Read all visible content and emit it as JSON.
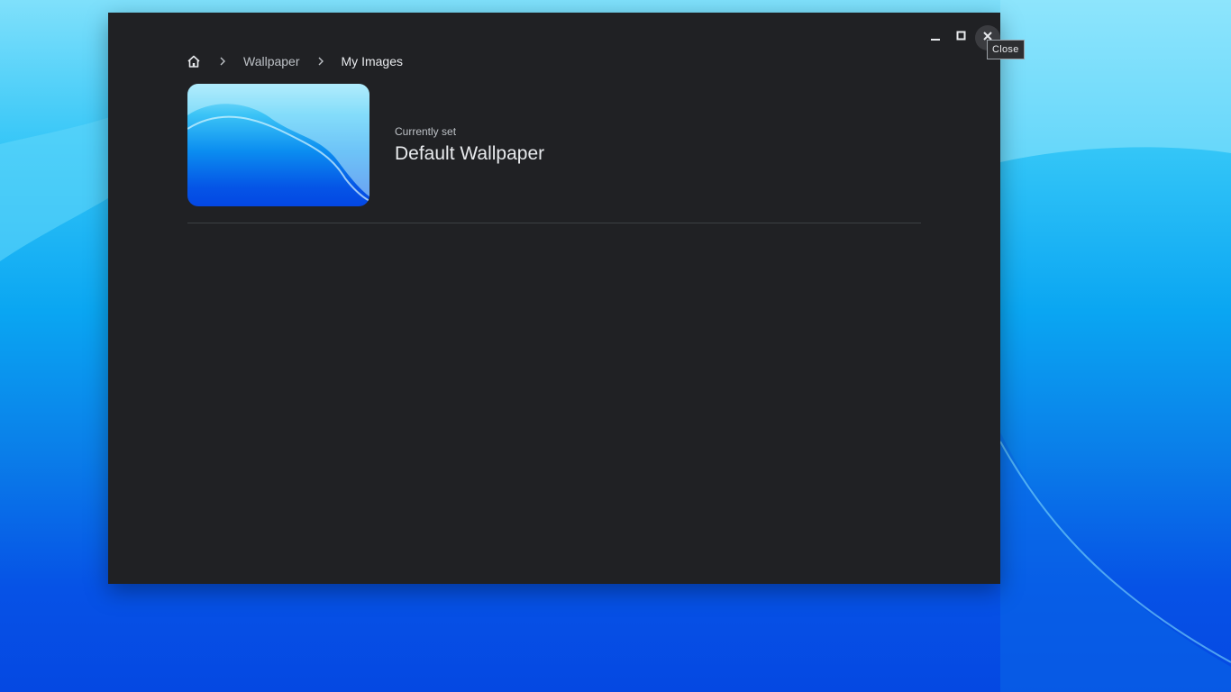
{
  "window": {
    "caption_buttons": {
      "minimize_icon": "minimize-icon",
      "maximize_icon": "maximize-icon",
      "close_icon": "close-icon"
    },
    "tooltip": "Close"
  },
  "breadcrumb": {
    "home_icon": "home-icon",
    "items": [
      "Wallpaper",
      "My Images"
    ]
  },
  "current_wallpaper": {
    "label": "Currently set",
    "name": "Default Wallpaper"
  },
  "colors": {
    "window_bg": "#202124",
    "text_primary": "#e8eaed",
    "text_secondary": "#bdc1c6",
    "divider": "#3c4043"
  }
}
